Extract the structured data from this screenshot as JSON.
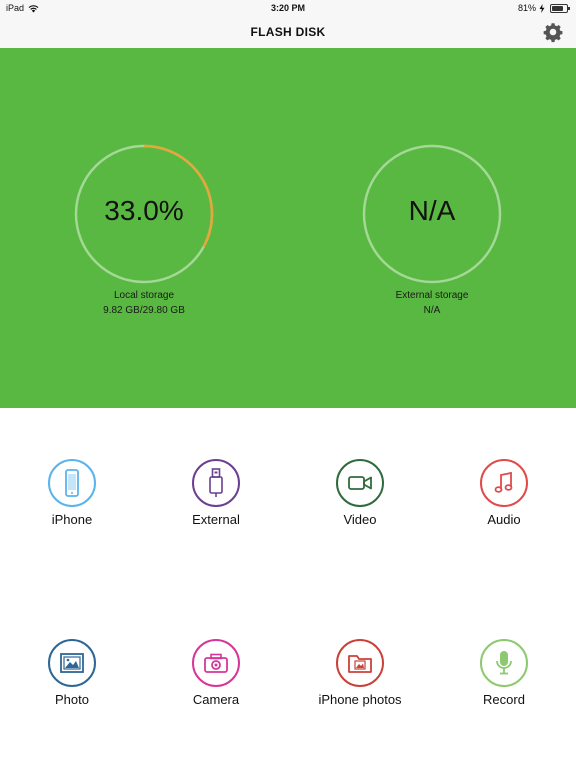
{
  "status_bar": {
    "device": "iPad",
    "time": "3:20 PM",
    "battery_percent": "81%",
    "battery_level": 0.81,
    "icons": [
      "wifi-icon",
      "charging-icon",
      "battery-icon"
    ]
  },
  "nav": {
    "title": "FLASH DISK",
    "settings_icon": "gear-icon"
  },
  "storage": {
    "background_color": "#59b841",
    "local": {
      "percent_text": "33.0%",
      "used_fraction": 0.33,
      "label": "Local storage",
      "detail": "9.82 GB/29.80 GB",
      "ring_color": "#e8a63a"
    },
    "external": {
      "percent_text": "N/A",
      "used_fraction": 0,
      "label": "External storage",
      "detail": "N/A"
    }
  },
  "tiles": [
    {
      "label": "iPhone",
      "icon": "iphone-icon",
      "color": "#5ab4ec"
    },
    {
      "label": "External",
      "icon": "usb-drive-icon",
      "color": "#6c3f8f"
    },
    {
      "label": "Video",
      "icon": "video-camera-icon",
      "color": "#2e6b3e"
    },
    {
      "label": "Audio",
      "icon": "music-note-icon",
      "color": "#de4b4b"
    },
    {
      "label": "Photo",
      "icon": "photo-icon",
      "color": "#2e6796"
    },
    {
      "label": "Camera",
      "icon": "camera-icon",
      "color": "#d6369a"
    },
    {
      "label": "iPhone photos",
      "icon": "photo-folder-icon",
      "color": "#c9423a"
    },
    {
      "label": "Record",
      "icon": "microphone-icon",
      "color": "#8cc96f"
    }
  ]
}
